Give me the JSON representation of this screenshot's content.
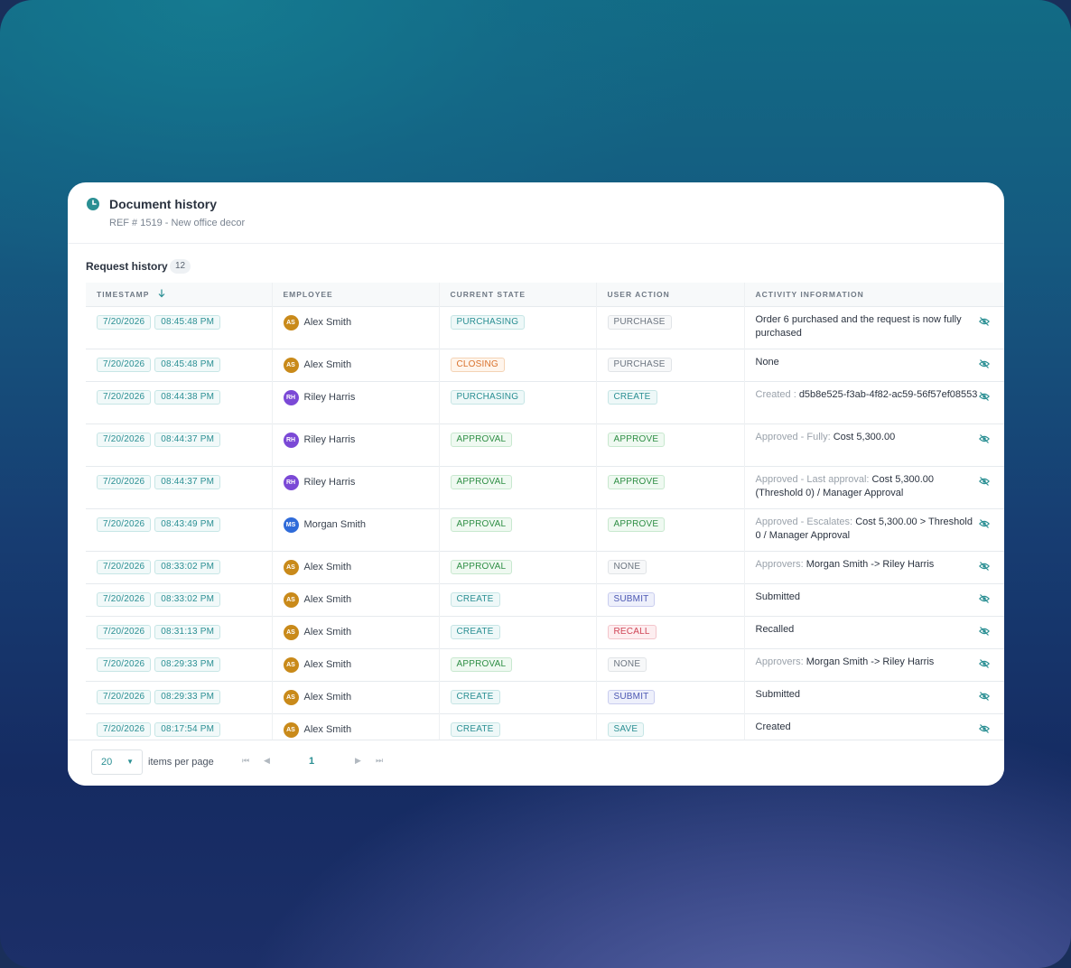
{
  "header": {
    "title": "Document history",
    "subtitle": "REF # 1519 - New office decor"
  },
  "section": {
    "title": "Request history",
    "count": "12"
  },
  "columns": {
    "timestamp": "TIMESTAMP",
    "employee": "EMPLOYEE",
    "current_state": "CURRENT STATE",
    "user_action": "USER ACTION",
    "activity": "ACTIVITY INFORMATION"
  },
  "rows": [
    {
      "date": "7/20/2026",
      "time": "08:45:48 PM",
      "initials": "AS",
      "name": "Alex Smith",
      "state": "PURCHASING",
      "action": "PURCHASE",
      "act_label": "",
      "act_text": "Order 6 purchased and the request is now fully purchased"
    },
    {
      "date": "7/20/2026",
      "time": "08:45:48 PM",
      "initials": "AS",
      "name": "Alex Smith",
      "state": "CLOSING",
      "action": "PURCHASE",
      "act_label": "",
      "act_text": "None"
    },
    {
      "date": "7/20/2026",
      "time": "08:44:38 PM",
      "initials": "RH",
      "name": "Riley Harris",
      "state": "PURCHASING",
      "action": "CREATE",
      "act_label": "Created :",
      "act_text": "d5b8e525-f3ab-4f82-ac59-56f57ef08553"
    },
    {
      "date": "7/20/2026",
      "time": "08:44:37 PM",
      "initials": "RH",
      "name": "Riley Harris",
      "state": "APPROVAL",
      "action": "APPROVE",
      "act_label": "Approved - Fully:",
      "act_text": "Cost 5,300.00"
    },
    {
      "date": "7/20/2026",
      "time": "08:44:37 PM",
      "initials": "RH",
      "name": "Riley Harris",
      "state": "APPROVAL",
      "action": "APPROVE",
      "act_label": "Approved - Last approval:",
      "act_text": "Cost 5,300.00 (Threshold 0) / Manager Approval"
    },
    {
      "date": "7/20/2026",
      "time": "08:43:49 PM",
      "initials": "MS",
      "name": "Morgan Smith",
      "state": "APPROVAL",
      "action": "APPROVE",
      "act_label": "Approved - Escalates:",
      "act_text": "Cost 5,300.00 > Threshold 0 / Manager Approval"
    },
    {
      "date": "7/20/2026",
      "time": "08:33:02 PM",
      "initials": "AS",
      "name": "Alex Smith",
      "state": "APPROVAL",
      "action": "NONE",
      "act_label": "Approvers:",
      "act_text": "Morgan Smith -> Riley Harris"
    },
    {
      "date": "7/20/2026",
      "time": "08:33:02 PM",
      "initials": "AS",
      "name": "Alex Smith",
      "state": "CREATE",
      "action": "SUBMIT",
      "act_label": "",
      "act_text": "Submitted"
    },
    {
      "date": "7/20/2026",
      "time": "08:31:13 PM",
      "initials": "AS",
      "name": "Alex Smith",
      "state": "CREATE",
      "action": "RECALL",
      "act_label": "",
      "act_text": "Recalled"
    },
    {
      "date": "7/20/2026",
      "time": "08:29:33 PM",
      "initials": "AS",
      "name": "Alex Smith",
      "state": "APPROVAL",
      "action": "NONE",
      "act_label": "Approvers:",
      "act_text": "Morgan Smith -> Riley Harris"
    },
    {
      "date": "7/20/2026",
      "time": "08:29:33 PM",
      "initials": "AS",
      "name": "Alex Smith",
      "state": "CREATE",
      "action": "SUBMIT",
      "act_label": "",
      "act_text": "Submitted"
    },
    {
      "date": "7/20/2026",
      "time": "08:17:54 PM",
      "initials": "AS",
      "name": "Alex Smith",
      "state": "CREATE",
      "action": "SAVE",
      "act_label": "",
      "act_text": "Created"
    }
  ],
  "footer": {
    "per_page": "20",
    "per_page_label": "items per page",
    "current_page": "1"
  },
  "avatar_colors": {
    "AS": "#c98a1a",
    "RH": "#7b49d6",
    "MS": "#2f6bd9"
  },
  "accent_color": "#2a8f93"
}
